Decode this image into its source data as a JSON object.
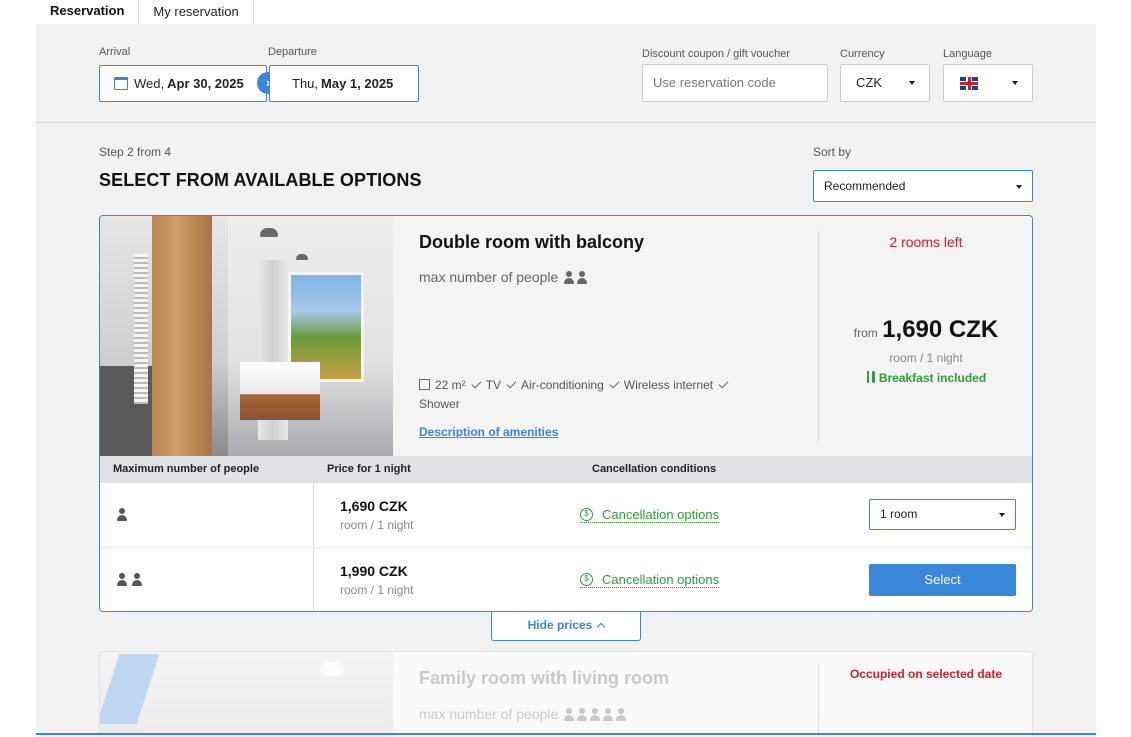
{
  "tabs": [
    {
      "label": "Reservation",
      "active": true
    },
    {
      "label": "My reservation",
      "active": false
    }
  ],
  "form": {
    "arrival_label": "Arrival",
    "arrival_day": "Wed,",
    "arrival_date": "Apr 30, 2025",
    "departure_label": "Departure",
    "departure_day": "Thu,",
    "departure_date": "May 1, 2025",
    "coupon_label": "Discount coupon / gift voucher",
    "coupon_placeholder": "Use reservation code",
    "currency_label": "Currency",
    "currency_value": "CZK",
    "language_label": "Language",
    "language_value": "gb-flag-icon"
  },
  "step": "Step 2 from 4",
  "heading": "SELECT FROM AVAILABLE OPTIONS",
  "sort": {
    "label": "Sort by",
    "value": "Recommended"
  },
  "room": {
    "title": "Double room with balcony",
    "max_people_label": "max number of people",
    "max_people": 2,
    "amenities_line1": [
      "22 m²",
      "TV",
      "Air-conditioning",
      "Wireless internet"
    ],
    "amenities_line2": "Shower",
    "amenities_link": "Description of amenities",
    "rooms_left": "2 rooms left",
    "from_label": "from",
    "price": "1,690 CZK",
    "per_night": "room / 1 night",
    "breakfast": "Breakfast included",
    "table_headers": {
      "people": "Maximum number of people",
      "price": "Price for 1 night",
      "cancel": "Cancellation conditions"
    },
    "rates": [
      {
        "people": 1,
        "price": "1,690 CZK",
        "per_night": "room / 1 night",
        "cancel": "Cancellation options",
        "action": "1 room"
      },
      {
        "people": 2,
        "price": "1,990 CZK",
        "per_night": "room / 1 night",
        "cancel": "Cancellation options",
        "action": "Select"
      }
    ]
  },
  "hide_prices": "Hide prices",
  "room2": {
    "title": "Family room with living room",
    "max_people_label": "max number of people",
    "max_people": 5,
    "status": "Occupied on selected date"
  },
  "colors": {
    "accent": "#3a86d8",
    "red": "#d0202a",
    "green": "#2e9d3c"
  }
}
